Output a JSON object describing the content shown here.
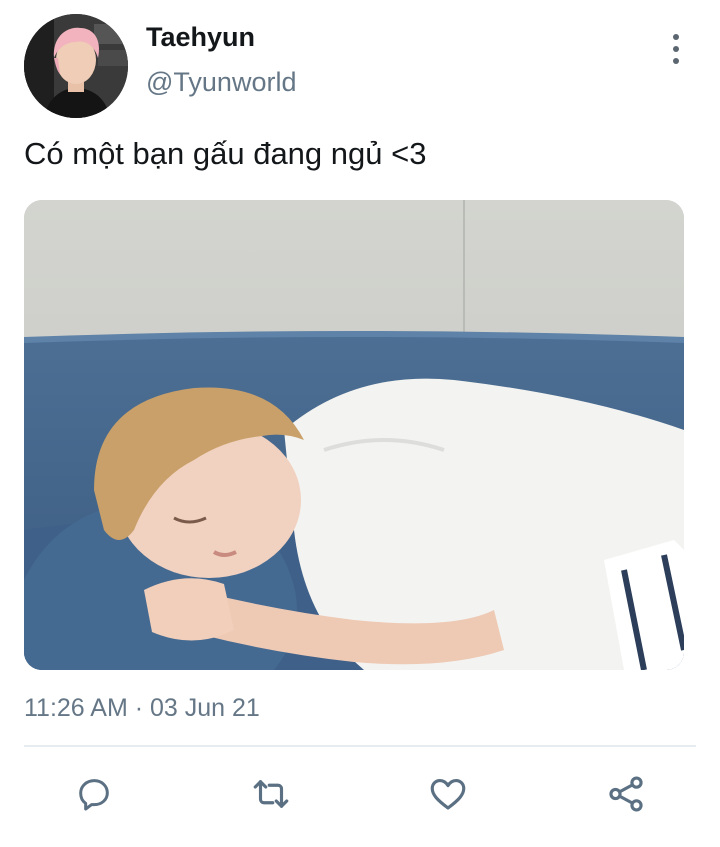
{
  "tweet": {
    "author_name": "Taehyun",
    "author_handle": "@Tyunworld",
    "text": "Có một bạn gấu đang ngủ <3",
    "timestamp": "11:26 AM · 03 Jun 21"
  },
  "icons": {
    "more": "more-vertical-icon",
    "reply": "reply-icon",
    "retweet": "retweet-icon",
    "like": "heart-icon",
    "share": "share-icon"
  },
  "colors": {
    "secondary_text": "#657786",
    "icon": "#5b7083",
    "divider": "#e6ecf0"
  }
}
